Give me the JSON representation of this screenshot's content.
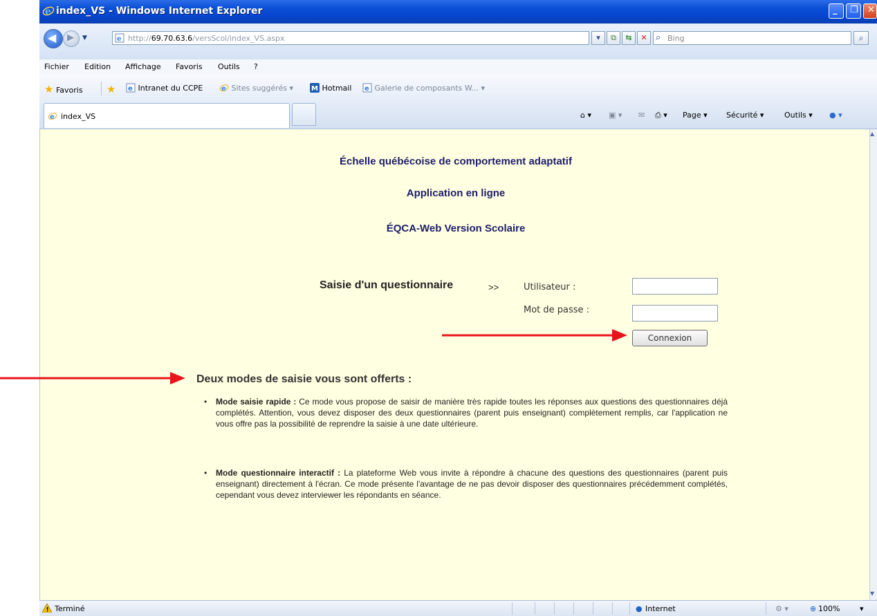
{
  "window": {
    "title": "index_VS - Windows Internet Explorer"
  },
  "address_bar": {
    "url_prefix": "http://",
    "url_host": "69.70.63.6",
    "url_path": "/versScol/index_VS.aspx",
    "search_placeholder": "Bing"
  },
  "menu": {
    "items": [
      "Fichier",
      "Edition",
      "Affichage",
      "Favoris",
      "Outils",
      "?"
    ]
  },
  "favorites_bar": {
    "favorites_label": "Favoris",
    "items": [
      {
        "label": "Intranet du CCPE"
      },
      {
        "label": "Sites suggérés ▾"
      },
      {
        "label": "Hotmail"
      },
      {
        "label": "Galerie de composants W... ▾"
      }
    ]
  },
  "tabs": {
    "active_label": "index_VS"
  },
  "command_bar": {
    "page": "Page ▾",
    "securite": "Sécurité ▾",
    "outils": "Outils ▾"
  },
  "page": {
    "title": "Échelle québécoise de comportement adaptatif",
    "subtitle": "Application en ligne",
    "version": "ÉQCA-Web Version Scolaire",
    "login": {
      "heading": "Saisie d'un questionnaire",
      "arrow_text": ">>",
      "user_label": "Utilisateur :",
      "user_value": "",
      "password_label": "Mot de passe :",
      "password_value": "",
      "submit_label": "Connexion"
    },
    "modes": {
      "heading": "Deux modes de saisie vous sont offerts :",
      "items": [
        {
          "title": "Mode saisie rapide :",
          "text": " Ce mode vous propose de saisir de manière très rapide toutes les réponses aux questions des questionnaires déjà complétés. Attention, vous devez disposer des deux questionnaires (parent puis enseignant) complètement remplis, car l'application ne vous offre pas la possibilité de reprendre la saisie à une date ultérieure."
        },
        {
          "title": "Mode questionnaire interactif :",
          "text": " La plateforme Web vous invite à répondre à chacune des questions des questionnaires (parent puis enseignant) directement à l'écran. Ce mode présente l'avantage de ne pas devoir disposer des questionnaires précédemment complétés, cependant vous devez interviewer les répondants en séance."
        }
      ]
    }
  },
  "status_bar": {
    "status_text": "Terminé",
    "zone": "Internet",
    "zoom": "100%"
  },
  "colors": {
    "page_background": "#ffffe1",
    "heading_navy": "#1d1d6b",
    "annotation_red": "#e8141b",
    "titlebar_blue": "#0a4fd6"
  }
}
